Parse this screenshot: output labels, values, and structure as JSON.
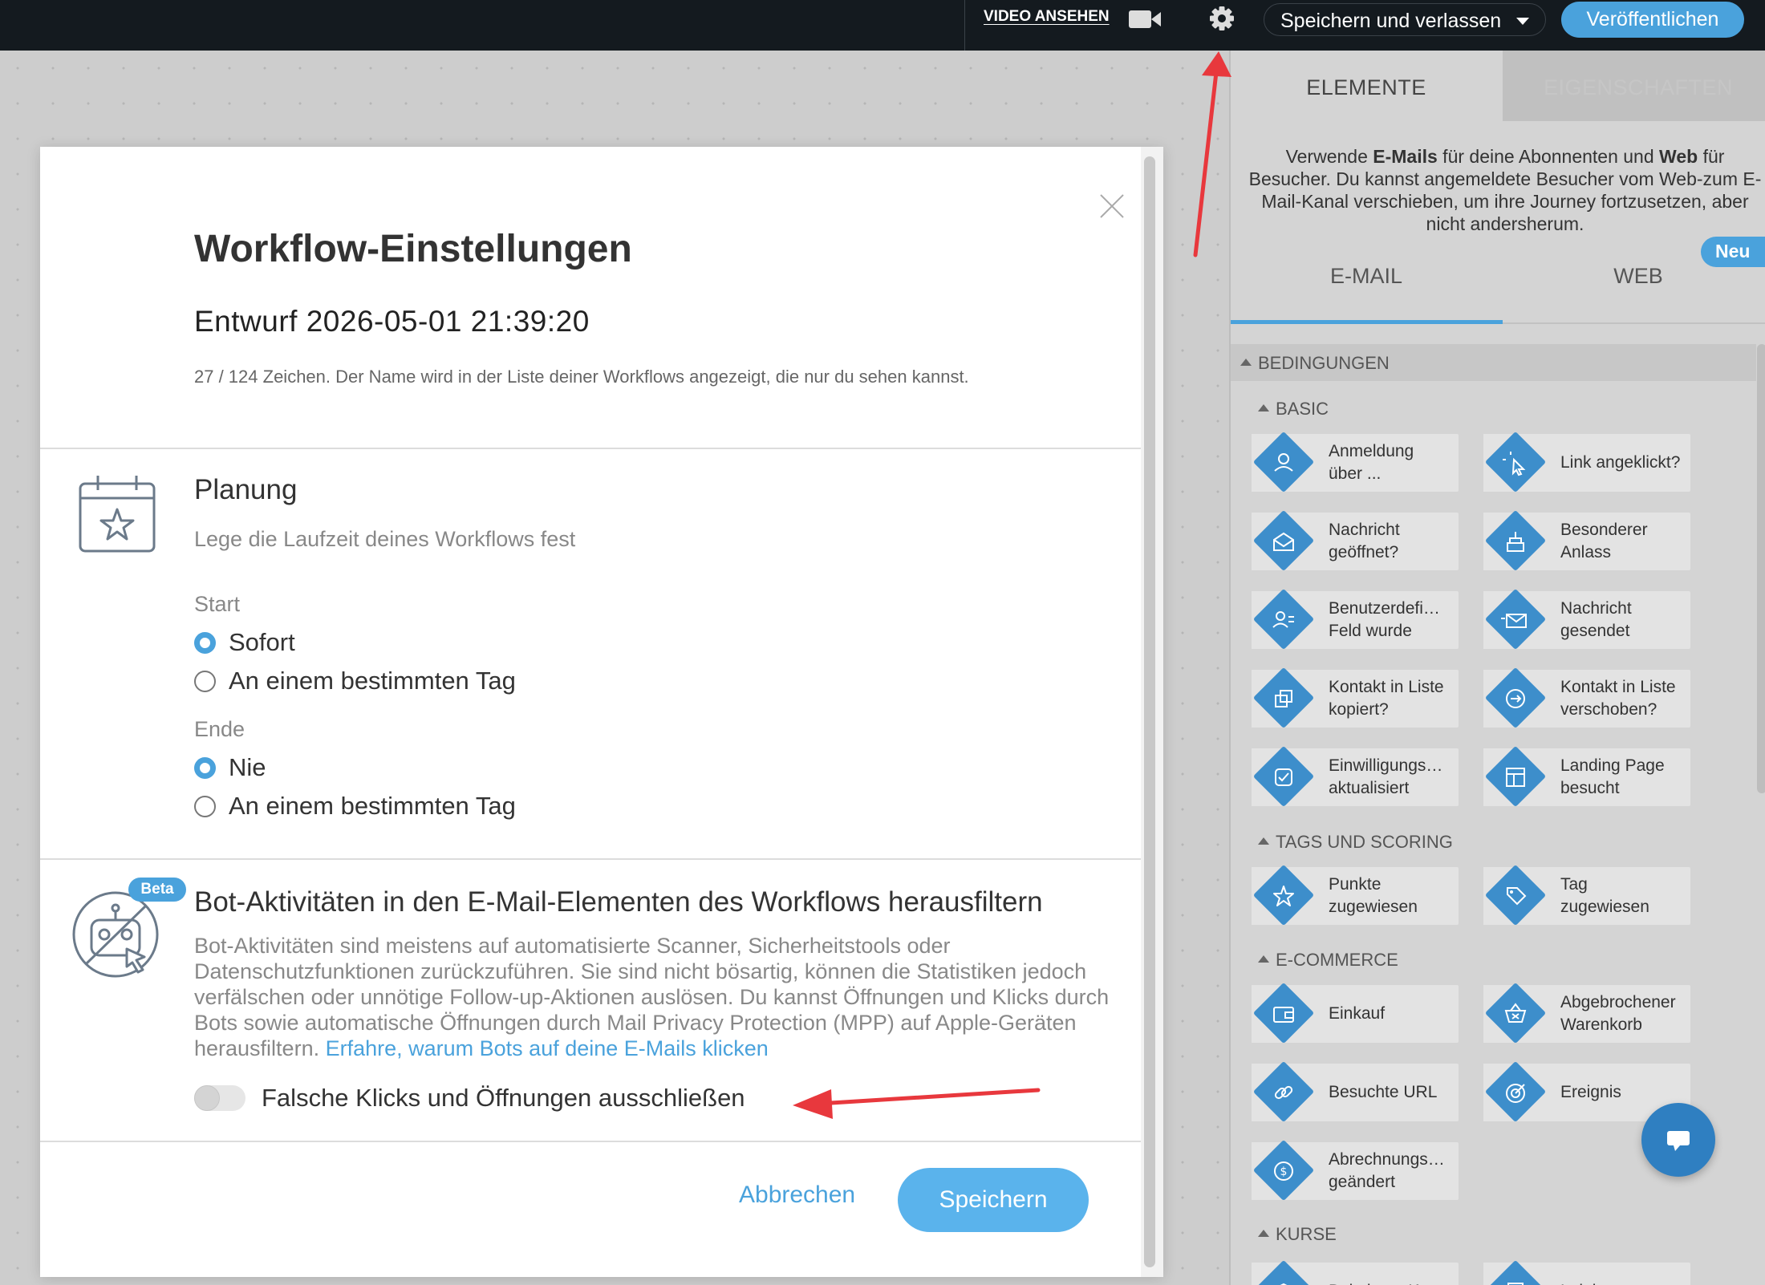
{
  "topbar": {
    "video_label": "VIDEO ANSEHEN",
    "save_leave_label": "Speichern und verlassen",
    "publish_label": "Veröffentlichen"
  },
  "panel": {
    "tabs": [
      "ELEMENTE",
      "EIGENSCHAFTEN"
    ],
    "info_html_parts": {
      "p1": "Verwende ",
      "b1": "E-Mails",
      "p2": " für deine Abonnenten und ",
      "b2": "Web",
      "p3": " für Besucher. Du kannst angemeldete Besucher vom Web-zum E-Mail-Kanal verschieben, um ihre Journey fortzusetzen, aber nicht andersherum."
    },
    "badge_new": "Neu",
    "sub_tabs": [
      "E-MAIL",
      "WEB"
    ],
    "section": "BEDINGUNGEN",
    "groups": {
      "basic": "BASIC",
      "tags": "TAGS UND SCORING",
      "ecommerce": "E-COMMERCE",
      "kurse": "KURSE"
    },
    "items": [
      {
        "label": "Anmeldung\nüber ...",
        "icon": "user-icon"
      },
      {
        "label": "Link angeklickt?",
        "icon": "cursor-click-icon"
      },
      {
        "label": "Nachricht\ngeöffnet?",
        "icon": "open-mail-icon"
      },
      {
        "label": "Besonderer\nAnlass",
        "icon": "cake-icon"
      },
      {
        "label": "Benutzerdefi…\nFeld wurde",
        "icon": "user-field-icon"
      },
      {
        "label": "Nachricht\ngesendet",
        "icon": "send-mail-icon"
      },
      {
        "label": "Kontakt in Liste\nkopiert?",
        "icon": "copy-icon"
      },
      {
        "label": "Kontakt in Liste\nverschoben?",
        "icon": "move-icon"
      },
      {
        "label": "Einwilligungs…\naktualisiert",
        "icon": "consent-check-icon"
      },
      {
        "label": "Landing Page\nbesucht",
        "icon": "landing-page-icon"
      },
      {
        "label": "Punkte\nzugewiesen",
        "icon": "star-icon"
      },
      {
        "label": "Tag\nzugewiesen",
        "icon": "tag-icon"
      },
      {
        "label": "Einkauf",
        "icon": "wallet-icon"
      },
      {
        "label": "Abgebrochener\nWarenkorb",
        "icon": "basket-icon"
      },
      {
        "label": "Besuchte URL",
        "icon": "link-icon"
      },
      {
        "label": "Ereignis",
        "icon": "target-icon"
      },
      {
        "label": "Abrechnungs…\ngeändert",
        "icon": "billing-icon"
      },
      {
        "label": "Bei einem Kurs",
        "icon": "course-icon"
      },
      {
        "label": "Lektion",
        "icon": "lesson-icon"
      }
    ]
  },
  "modal": {
    "title": "Workflow-Einstellungen",
    "name_value": "Entwurf 2026-05-01 21:39:20",
    "name_hint": "27 / 124 Zeichen. Der Name wird in der Liste deiner Workflows angezeigt, die nur du sehen kannst.",
    "planning": {
      "title": "Planung",
      "subtitle": "Lege die Laufzeit deines Workflows fest",
      "start_label": "Start",
      "start_options": [
        "Sofort",
        "An einem bestimmten Tag"
      ],
      "start_selected": "Sofort",
      "end_label": "Ende",
      "end_options": [
        "Nie",
        "An einem bestimmten Tag"
      ],
      "end_selected": "Nie"
    },
    "bot": {
      "badge": "Beta",
      "title": "Bot-Aktivitäten in den E-Mail-Elementen des Workflows herausfiltern",
      "description": "Bot-Aktivitäten sind meistens auf automatisierte Scanner, Sicherheitstools oder Datenschutzfunktionen zurückzuführen. Sie sind nicht bösartig, können die Statistiken jedoch verfälschen oder unnötige Follow-up-Aktionen auslösen. Du kannst Öffnungen und Klicks durch Bots sowie automatische Öffnungen durch Mail Privacy Protection (MPP) auf Apple-Geräten herausfiltern. ",
      "link": "Erfahre, warum Bots auf deine E-Mails klicken",
      "toggle_label": "Falsche Klicks und Öffnungen ausschließen",
      "toggle_on": false
    },
    "cancel_label": "Abbrechen",
    "save_label": "Speichern"
  },
  "colors": {
    "accent": "#4aa2dc",
    "annotation_arrow": "#e8383d",
    "topbar": "#141a1f"
  }
}
